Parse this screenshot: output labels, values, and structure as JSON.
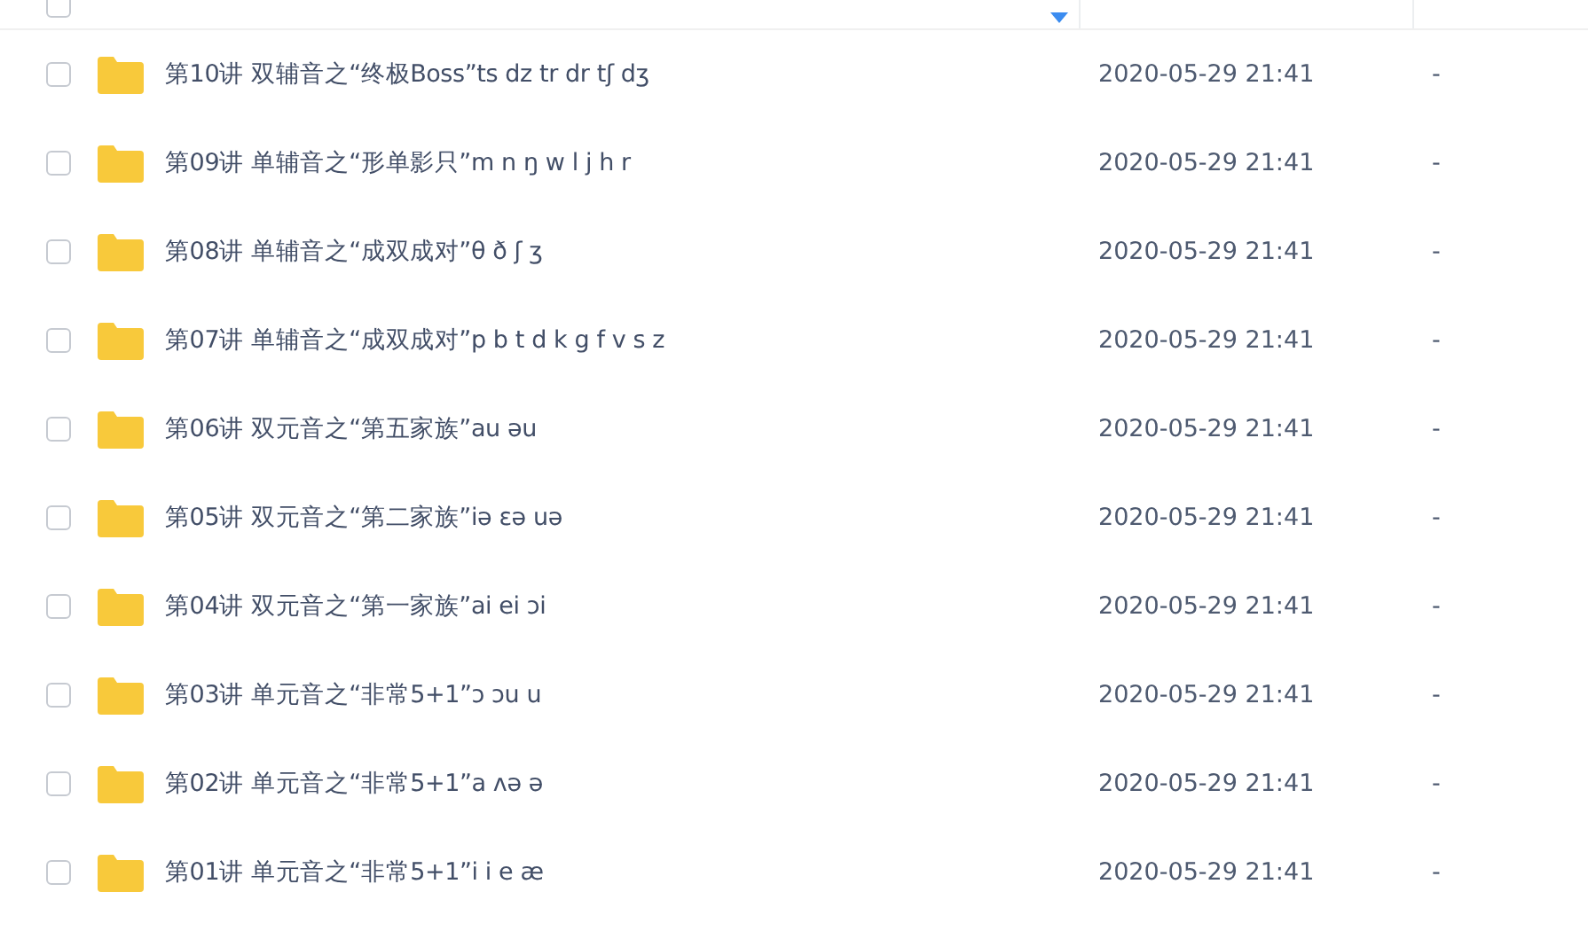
{
  "header": {
    "checked": false,
    "sort_descending": true
  },
  "rows": [
    {
      "name": "第10讲 双辅音之“终极Boss”ts dz tr dr tʃ dʒ",
      "modified": "2020-05-29 21:41",
      "size": "-",
      "checked": false
    },
    {
      "name": "第09讲 单辅音之“形单影只”m n ŋ w l j h r",
      "modified": "2020-05-29 21:41",
      "size": "-",
      "checked": false
    },
    {
      "name": "第08讲 单辅音之“成双成对”θ ð ʃ ʒ",
      "modified": "2020-05-29 21:41",
      "size": "-",
      "checked": false
    },
    {
      "name": "第07讲 单辅音之“成双成对”p b t d k g f v s z",
      "modified": "2020-05-29 21:41",
      "size": "-",
      "checked": false
    },
    {
      "name": "第06讲 双元音之“第五家族”au əu",
      "modified": "2020-05-29 21:41",
      "size": "-",
      "checked": false
    },
    {
      "name": "第05讲 双元音之“第二家族”iə ɛə uə",
      "modified": "2020-05-29 21:41",
      "size": "-",
      "checked": false
    },
    {
      "name": "第04讲 双元音之“第一家族”ai ei ɔi",
      "modified": "2020-05-29 21:41",
      "size": "-",
      "checked": false
    },
    {
      "name": "第03讲 单元音之“非常5+1”ɔ ɔu u",
      "modified": "2020-05-29 21:41",
      "size": "-",
      "checked": false
    },
    {
      "name": "第02讲 单元音之“非常5+1”a ʌə ə",
      "modified": "2020-05-29 21:41",
      "size": "-",
      "checked": false
    },
    {
      "name": "第01讲 单元音之“非常5+1”i i e æ",
      "modified": "2020-05-29 21:41",
      "size": "-",
      "checked": false
    }
  ]
}
